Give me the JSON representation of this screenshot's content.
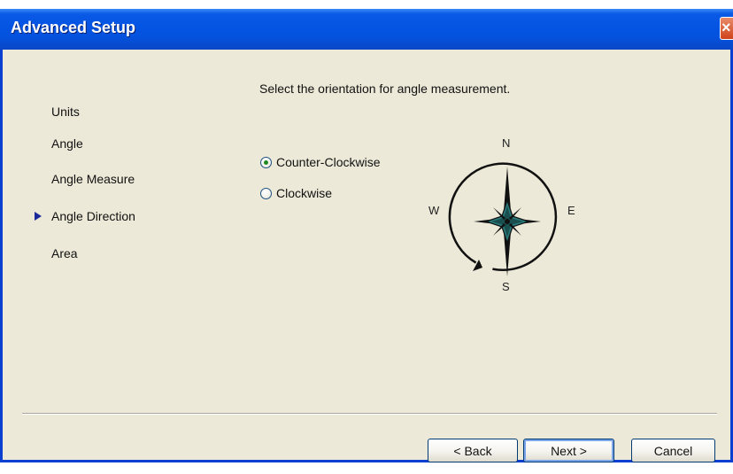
{
  "window": {
    "title": "Advanced Setup",
    "close_glyph": "×"
  },
  "nav": {
    "items": [
      {
        "label": "Units"
      },
      {
        "label": "Angle"
      },
      {
        "label": "Angle Measure"
      },
      {
        "label": "Angle Direction",
        "current": true
      },
      {
        "label": "Area"
      }
    ]
  },
  "content": {
    "instruction": "Select the orientation for angle measurement.",
    "options": [
      {
        "label": "Counter-Clockwise",
        "selected": true
      },
      {
        "label": "Clockwise",
        "selected": false
      }
    ],
    "compass": {
      "north": "N",
      "east": "E",
      "south": "S",
      "west": "W"
    }
  },
  "buttons": {
    "back": "< Back",
    "next": "Next >",
    "cancel": "Cancel"
  },
  "colors": {
    "titlebar": "#0554e3",
    "window_bg": "#ece9d8",
    "close": "#d0421b",
    "radio_dot": "#1f8a1f",
    "compass_star": "#2a7b7b"
  },
  "icons": {
    "current_step": "triangle-pointer-icon",
    "close": "close-icon",
    "compass": "compass-rose-icon"
  }
}
